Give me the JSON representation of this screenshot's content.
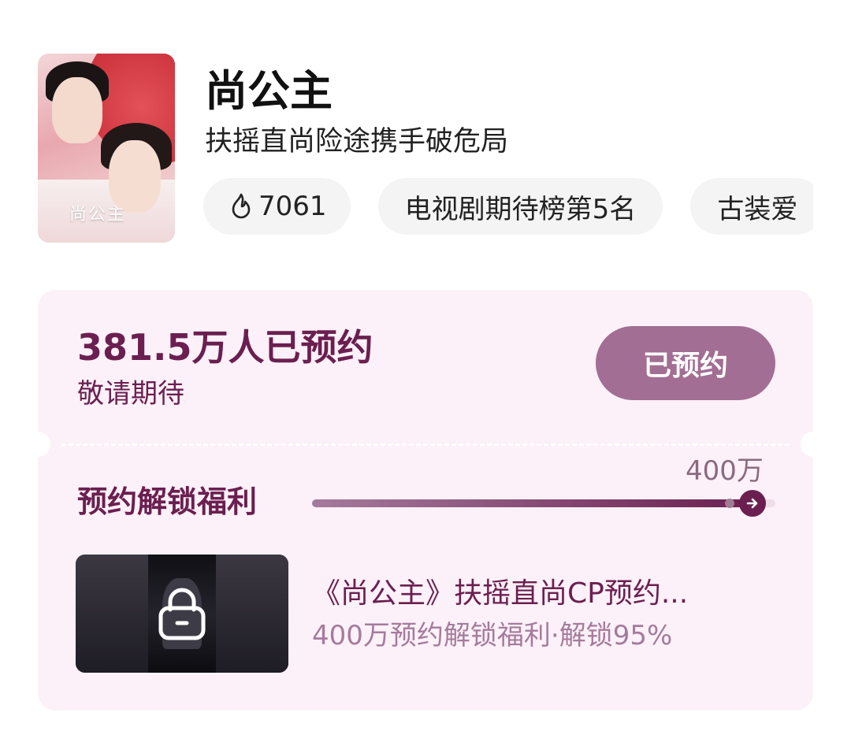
{
  "show": {
    "title": "尚公主",
    "subtitle": "扶摇直尚险途携手破危局",
    "poster_logo": "尚公主",
    "tags": [
      {
        "icon": "flame-icon",
        "label": "7061"
      },
      {
        "label": "电视剧期待榜第5名"
      },
      {
        "label": "古装爱"
      }
    ]
  },
  "reservation": {
    "count_text": "381.5万人已预约",
    "hint": "敬请期待",
    "button_label": "已预约"
  },
  "benefits": {
    "label": "预约解锁福利",
    "target_label": "400万",
    "progress_fraction": 0.95,
    "item": {
      "icon": "lock-icon",
      "title": "《尚公主》扶摇直尚CP预约...",
      "subtitle": "400万预约解锁福利·解锁95%"
    }
  },
  "colors": {
    "accent": "#6b1f50",
    "button_bg": "#a26e94",
    "card_bg": "#fcf1f8",
    "muted": "#a57b9c"
  }
}
